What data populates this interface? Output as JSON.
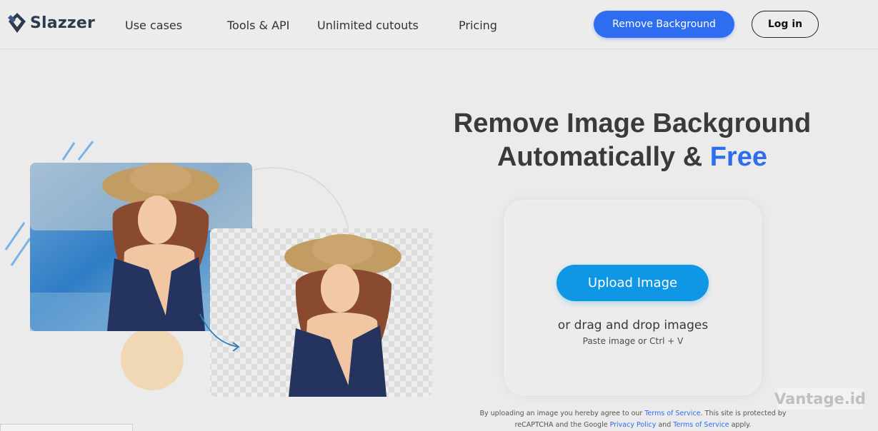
{
  "brand": {
    "name": "Slazzer",
    "color": "#2d3a4f"
  },
  "nav": {
    "items": [
      "Use cases",
      "Tools & API",
      "Unlimited cutouts",
      "Pricing"
    ]
  },
  "header_actions": {
    "remove_background_label": "Remove Background",
    "login_label": "Log in"
  },
  "hero": {
    "title_line1": "Remove Image Background",
    "title_line2_prefix": "Automatically & ",
    "title_line2_accent": "Free",
    "accent_color": "#2f6df0"
  },
  "upload": {
    "button_label": "Upload Image",
    "drag_drop_text": "or drag and drop images",
    "paste_text": "Paste image or Ctrl + V",
    "button_color": "#0f96e5"
  },
  "legal": {
    "text_1": "By uploading an image you hereby agree to our ",
    "terms_link": "Terms of Service",
    "text_2": ". This site is protected by reCAPTCHA and the Google ",
    "privacy_link": "Privacy Policy",
    "text_3": " and ",
    "terms_link_2": "Terms of Service",
    "text_4": " apply."
  },
  "watermark": {
    "text": "Vantage.id"
  },
  "icons": [
    "slazzer-logo-icon",
    "arrow-icon",
    "photo-original",
    "photo-cutout"
  ]
}
